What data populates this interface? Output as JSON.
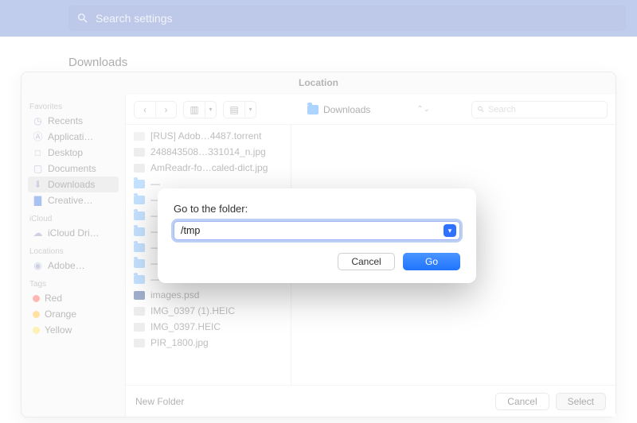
{
  "topbar": {
    "placeholder": "Search settings"
  },
  "page_title": "Downloads",
  "sheet": {
    "title": "Location",
    "sidebar": {
      "groups": [
        {
          "title": "Favorites",
          "items": [
            {
              "icon": "clock",
              "label": "Recents"
            },
            {
              "icon": "app",
              "label": "Applicati…"
            },
            {
              "icon": "desk",
              "label": "Desktop"
            },
            {
              "icon": "doc",
              "label": "Documents"
            },
            {
              "icon": "down",
              "label": "Downloads",
              "selected": true
            },
            {
              "icon": "fold",
              "label": "Creative…",
              "blue": true
            }
          ]
        },
        {
          "title": "iCloud",
          "items": [
            {
              "icon": "cloud",
              "label": "iCloud Dri…"
            }
          ]
        },
        {
          "title": "Locations",
          "items": [
            {
              "icon": "disk",
              "label": "Adobe…"
            }
          ]
        },
        {
          "title": "Tags",
          "items": [
            {
              "dot": "red",
              "label": "Red"
            },
            {
              "dot": "org",
              "label": "Orange"
            },
            {
              "dot": "yel",
              "label": "Yellow"
            }
          ]
        }
      ]
    },
    "toolbar": {
      "current_folder": "Downloads",
      "search_placeholder": "Search"
    },
    "files": [
      {
        "kind": "doc",
        "name": "[RUS] Adob…4487.torrent"
      },
      {
        "kind": "img",
        "name": "248843508…331014_n.jpg"
      },
      {
        "kind": "img",
        "name": "AmReadr-fo…caled-dict.jpg"
      },
      {
        "kind": "fold",
        "name": "—"
      },
      {
        "kind": "fold",
        "name": "—"
      },
      {
        "kind": "fold",
        "name": "—"
      },
      {
        "kind": "fold",
        "name": "—"
      },
      {
        "kind": "fold",
        "name": "—"
      },
      {
        "kind": "fold",
        "name": "—"
      },
      {
        "kind": "fold",
        "name": "—"
      },
      {
        "kind": "psd",
        "name": "images.psd"
      },
      {
        "kind": "img",
        "name": "IMG_0397 (1).HEIC"
      },
      {
        "kind": "img",
        "name": "IMG_0397.HEIC"
      },
      {
        "kind": "img",
        "name": "PIR_1800.jpg"
      }
    ],
    "footer": {
      "new_folder": "New Folder",
      "cancel": "Cancel",
      "select": "Select"
    }
  },
  "modal": {
    "label": "Go to the folder:",
    "value": "/tmp",
    "cancel": "Cancel",
    "go": "Go"
  }
}
